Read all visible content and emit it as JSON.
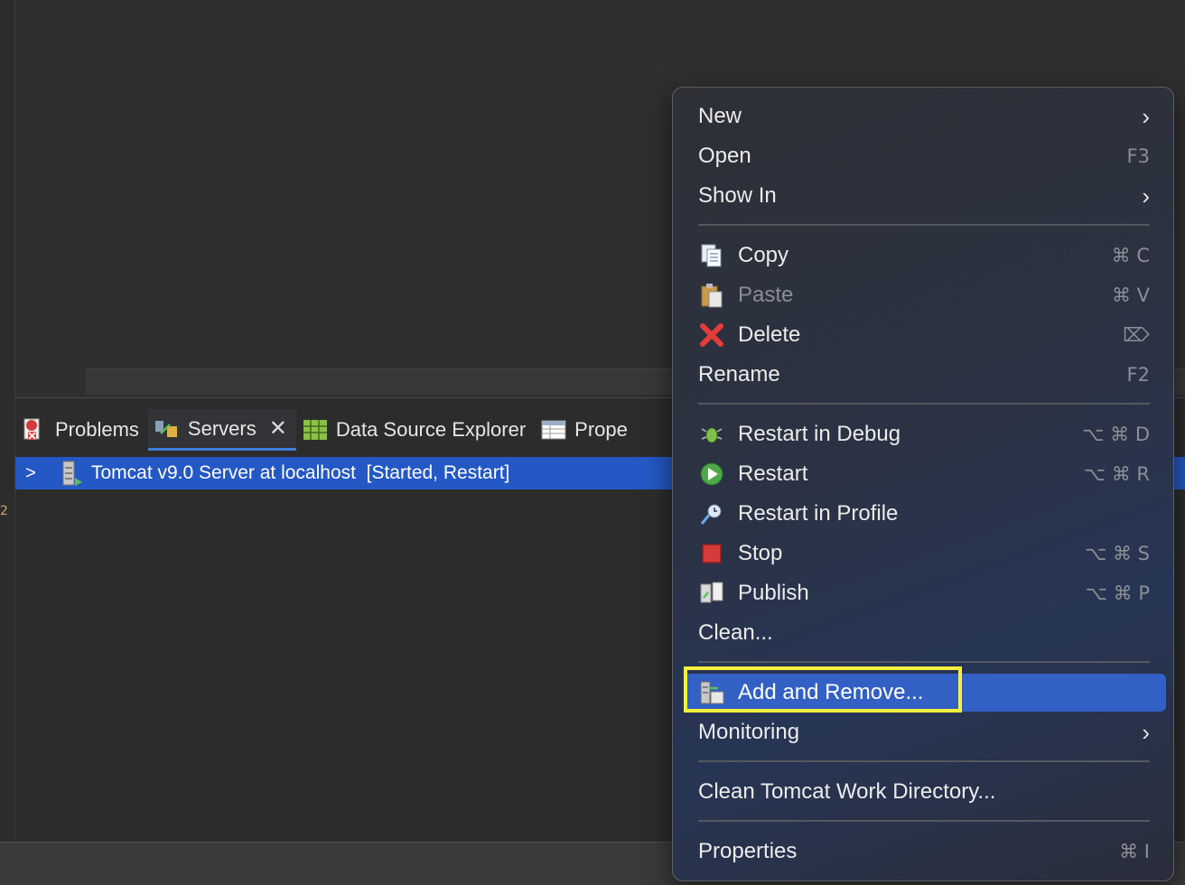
{
  "tabs": [
    {
      "label": "Problems"
    },
    {
      "label": "Servers"
    },
    {
      "label": "Data Source Explorer"
    },
    {
      "label": "Prope"
    }
  ],
  "server_row": {
    "label": "Tomcat v9.0 Server at localhost  [Started, Restart]"
  },
  "gutter_mark": "2",
  "menu": {
    "new": {
      "label": "New"
    },
    "open": {
      "label": "Open",
      "shortcut": "F3"
    },
    "show_in": {
      "label": "Show In"
    },
    "copy": {
      "label": "Copy",
      "shortcut": "⌘ C"
    },
    "paste": {
      "label": "Paste",
      "shortcut": "⌘ V"
    },
    "delete": {
      "label": "Delete",
      "shortcut": "⌦"
    },
    "rename": {
      "label": "Rename",
      "shortcut": "F2"
    },
    "restart_debug": {
      "label": "Restart in Debug",
      "shortcut": "⌥ ⌘ D"
    },
    "restart": {
      "label": "Restart",
      "shortcut": "⌥ ⌘ R"
    },
    "restart_profile": {
      "label": "Restart in Profile"
    },
    "stop": {
      "label": "Stop",
      "shortcut": "⌥ ⌘ S"
    },
    "publish": {
      "label": "Publish",
      "shortcut": "⌥ ⌘ P"
    },
    "clean": {
      "label": "Clean..."
    },
    "add_remove": {
      "label": "Add and Remove..."
    },
    "monitoring": {
      "label": "Monitoring"
    },
    "clean_tomcat": {
      "label": "Clean Tomcat Work Directory..."
    },
    "properties": {
      "label": "Properties",
      "shortcut": "⌘ I"
    }
  },
  "colors": {
    "selection": "#2458c4",
    "menu_highlight": "#3360c4",
    "annotation_box": "#f6f03c"
  }
}
